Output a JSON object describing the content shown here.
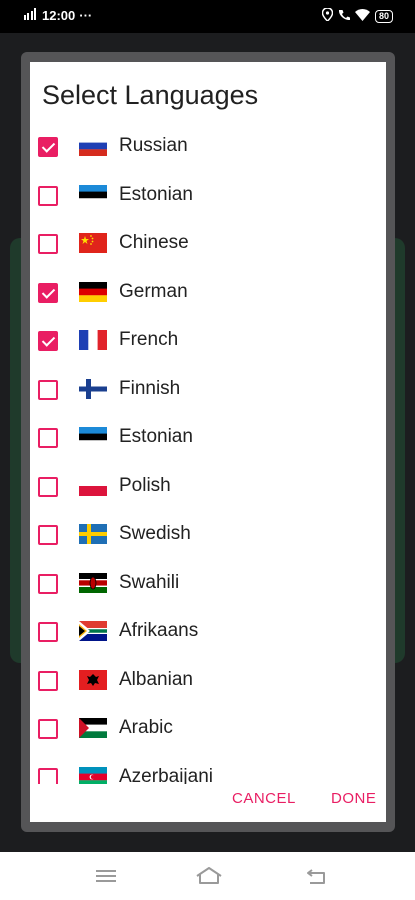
{
  "status_bar": {
    "time": "12:00",
    "dots": "···",
    "battery": "80",
    "icons": [
      "signal-icon",
      "location-icon",
      "call-icon",
      "wifi-icon",
      "battery-icon"
    ]
  },
  "dialog": {
    "title": "Select Languages",
    "accent_color": "#e91e63",
    "languages": [
      {
        "name": "Russian",
        "checked": true,
        "flag": "russia"
      },
      {
        "name": "Estonian",
        "checked": false,
        "flag": "estonia"
      },
      {
        "name": "Chinese",
        "checked": false,
        "flag": "china"
      },
      {
        "name": "German",
        "checked": true,
        "flag": "germany"
      },
      {
        "name": "French",
        "checked": true,
        "flag": "france"
      },
      {
        "name": "Finnish",
        "checked": false,
        "flag": "finland"
      },
      {
        "name": "Estonian",
        "checked": false,
        "flag": "estonia"
      },
      {
        "name": "Polish",
        "checked": false,
        "flag": "poland"
      },
      {
        "name": "Swedish",
        "checked": false,
        "flag": "sweden"
      },
      {
        "name": "Swahili",
        "checked": false,
        "flag": "kenya"
      },
      {
        "name": "Afrikaans",
        "checked": false,
        "flag": "south-africa"
      },
      {
        "name": "Albanian",
        "checked": false,
        "flag": "albania"
      },
      {
        "name": "Arabic",
        "checked": false,
        "flag": "arab"
      },
      {
        "name": "Azerbaijani",
        "checked": false,
        "flag": "azerbaijan"
      }
    ],
    "cancel_label": "CANCEL",
    "done_label": "DONE"
  },
  "nav_bar": {
    "icons": [
      "menu-icon",
      "home-icon",
      "back-icon"
    ]
  }
}
